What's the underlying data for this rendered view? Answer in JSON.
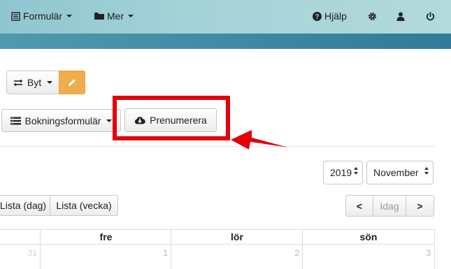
{
  "nav": {
    "formular_label": "Formulär",
    "mer_label": "Mer",
    "hjalp_label": "Hjälp"
  },
  "toolbar": {
    "byt_label": "Byt",
    "bokningsformular_label": "Bokningsformulär",
    "prenumerera_label": "Prenumerera"
  },
  "calendar": {
    "year": "2019",
    "month": "November",
    "view_day_label": "Lista (dag)",
    "view_week_label": "Lista (vecka)",
    "prev_label": "<",
    "today_label": "Idag",
    "next_label": ">",
    "headers": [
      "fre",
      "lör",
      "sön"
    ],
    "day_numbers": [
      "31",
      "1",
      "2",
      "3"
    ]
  },
  "colors": {
    "topbar": "#a6d3d8",
    "band": "#3c88a1",
    "edit_button": "#f0ad4e",
    "highlight": "#e3000b"
  }
}
